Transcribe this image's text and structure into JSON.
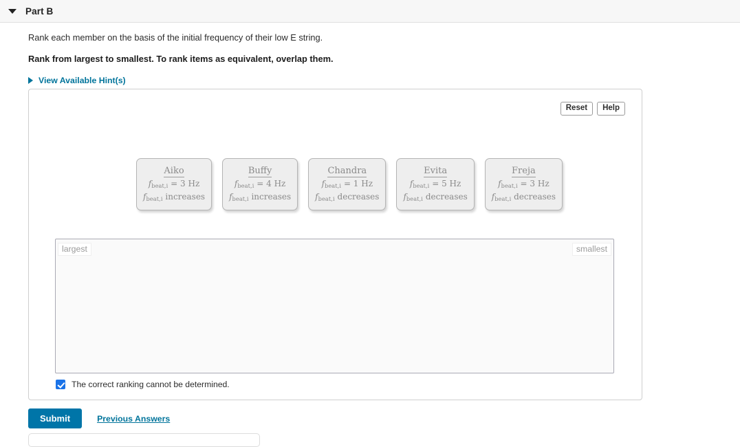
{
  "header": {
    "title": "Part B",
    "caret_icon": "caret-down-icon",
    "collapsed": false
  },
  "prompt": {
    "question": "Rank each member on the basis of the initial frequency of their low E string.",
    "instruction": "Rank from largest to smallest. To rank items as equivalent, overlap them.",
    "hints_label": "View Available Hint(s)",
    "hints_icon": "caret-right-icon"
  },
  "toolbar": {
    "reset_label": "Reset",
    "help_label": "Help"
  },
  "cards": [
    {
      "name": "Aiko",
      "symbol": "f",
      "subscript": "beat,i",
      "relation": "= 3 Hz",
      "trend_symbol": "f",
      "trend_subscript": "beat,i",
      "trend": "increases"
    },
    {
      "name": "Buffy",
      "symbol": "f",
      "subscript": "beat,i",
      "relation": "= 4 Hz",
      "trend_symbol": "f",
      "trend_subscript": "beat,i",
      "trend": "increases"
    },
    {
      "name": "Chandra",
      "symbol": "f",
      "subscript": "beat,i",
      "relation": "= 1 Hz",
      "trend_symbol": "f",
      "trend_subscript": "beat,i",
      "trend": "decreases"
    },
    {
      "name": "Evita",
      "symbol": "f",
      "subscript": "beat,i",
      "relation": "= 5 Hz",
      "trend_symbol": "f",
      "trend_subscript": "beat,i",
      "trend": "decreases"
    },
    {
      "name": "Freja",
      "symbol": "f",
      "subscript": "beat,i",
      "relation": "= 3 Hz",
      "trend_symbol": "f",
      "trend_subscript": "beat,i",
      "trend": "decreases"
    }
  ],
  "drop_zone": {
    "left_label": "largest",
    "right_label": "smallest",
    "placed_items": []
  },
  "cannot_determine": {
    "label": "The correct ranking cannot be determined.",
    "checked": true
  },
  "footer": {
    "submit_label": "Submit",
    "previous_answers_label": "Previous Answers"
  },
  "colors": {
    "accent": "#00749b",
    "submit": "#0075a8",
    "checkbox": "#1a73e8",
    "card_bg": "#eeeeee",
    "card_text": "#8a8a8a",
    "header_bg": "#f7f7f7"
  }
}
